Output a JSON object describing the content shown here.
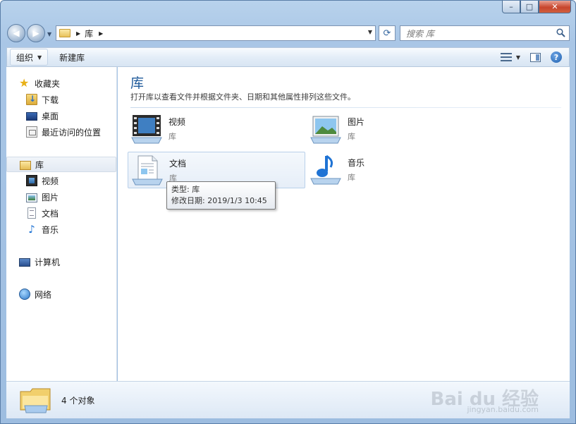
{
  "window": {
    "minimize_symbol": "–",
    "maximize_symbol": "□",
    "close_symbol": "✕"
  },
  "address_bar": {
    "segment": "库",
    "search_placeholder": "搜索 库"
  },
  "toolbar": {
    "organize_label": "组织",
    "new_library_label": "新建库"
  },
  "nav_pane": {
    "favorites_label": "收藏夹",
    "favorites": [
      "下载",
      "桌面",
      "最近访问的位置"
    ],
    "libraries_label": "库",
    "libraries": [
      "视频",
      "图片",
      "文档",
      "音乐"
    ],
    "computer_label": "计算机",
    "network_label": "网络"
  },
  "content": {
    "title": "库",
    "description": "打开库以查看文件并根据文件夹、日期和其他属性排列这些文件。",
    "tiles": [
      {
        "name": "视频",
        "type": "库",
        "icon": "video-library-icon"
      },
      {
        "name": "图片",
        "type": "库",
        "icon": "pictures-library-icon"
      },
      {
        "name": "文档",
        "type": "库",
        "icon": "documents-library-icon"
      },
      {
        "name": "音乐",
        "type": "库",
        "icon": "music-library-icon"
      }
    ]
  },
  "tooltip": {
    "type_line": "类型: 库",
    "date_line": "修改日期: 2019/1/3 10:45"
  },
  "status_bar": {
    "count_text": "4 个对象"
  },
  "watermark": {
    "main": "Bai du 经验",
    "sub": "jingyan.baidu.com"
  },
  "colors": {
    "title_blue": "#1e5a9a",
    "window_frame": "#a9c6e6"
  }
}
